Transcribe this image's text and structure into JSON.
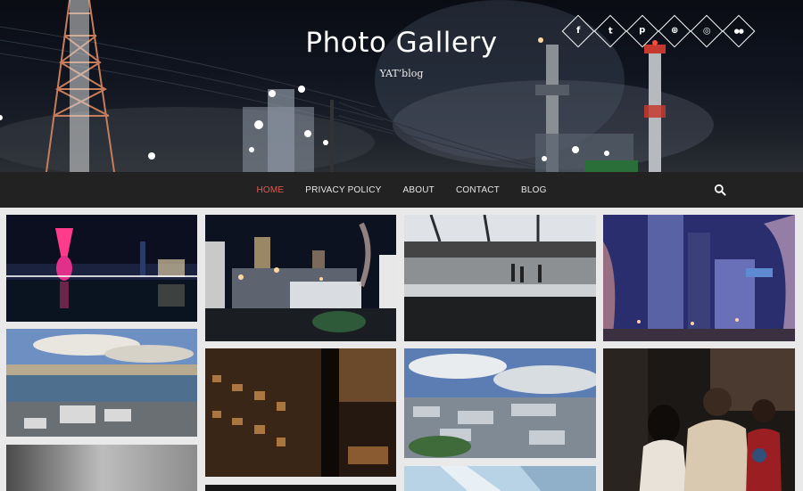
{
  "hero": {
    "title": "Photo Gallery",
    "subtitle": "YAT’blog"
  },
  "social": [
    {
      "name": "facebook",
      "glyph": "f"
    },
    {
      "name": "twitter",
      "glyph": "t"
    },
    {
      "name": "pinterest",
      "glyph": "p"
    },
    {
      "name": "dribbble",
      "glyph": "⊕"
    },
    {
      "name": "instagram",
      "glyph": "◎"
    },
    {
      "name": "flickr",
      "glyph": "●●"
    }
  ],
  "nav": {
    "items": [
      {
        "label": "HOME",
        "active": true
      },
      {
        "label": "PRIVACY POLICY"
      },
      {
        "label": "ABOUT"
      },
      {
        "label": "CONTACT"
      },
      {
        "label": "BLOG"
      }
    ],
    "search_icon": "search-icon"
  },
  "gallery": {
    "photos": [
      "night-bay-skyline",
      "industrial-plant-night",
      "train-platform",
      "city-street-night-lights",
      "aerial-harbor-view",
      "dark-cafe-interior",
      "aerial-city-clouds",
      "people-night-street",
      "grey-wall",
      "dark-night",
      "glass-building"
    ]
  },
  "colors": {
    "nav_bg": "#222222",
    "nav_active": "#e05a4e",
    "gallery_bg": "#e9e9ea"
  }
}
